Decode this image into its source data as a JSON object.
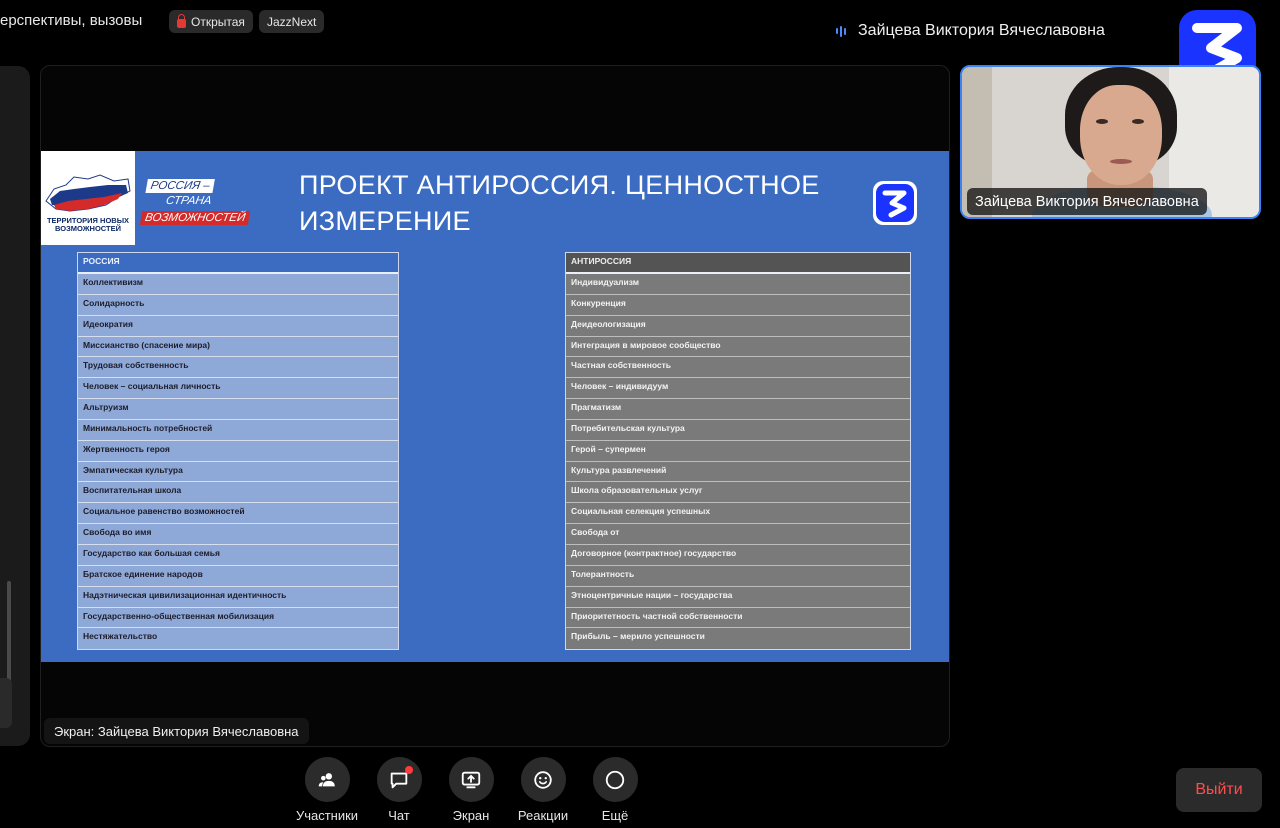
{
  "header": {
    "meeting_title": "ерспективы, вызовы",
    "badge_open": "Открытая",
    "badge_app": "JazzNext",
    "active_speaker": "Зайцева Виктория Вячеславовна"
  },
  "slide": {
    "logo_caption": "ТЕРРИТОРИЯ НОВЫХ ВОЗМОЖНОСТЕЙ",
    "slogan_line1": "РОССИЯ –",
    "slogan_line2": "СТРАНА",
    "slogan_line3": "ВОЗМОЖНОСТЕЙ",
    "title": "ПРОЕКТ АНТИРОССИЯ. ЦЕННОСТНОЕ ИЗМЕРЕНИЕ",
    "left_table": {
      "header": "РОССИЯ",
      "rows": [
        "Коллективизм",
        "Солидарность",
        "Идеократия",
        "Миссианство (спасение мира)",
        "Трудовая собственность",
        "Человек – социальная личность",
        "Альтруизм",
        "Минимальность потребностей",
        "Жертвенность героя",
        "Эмпатическая культура",
        "Воспитательная школа",
        "Социальное равенство возможностей",
        "Свобода во имя",
        "Государство как большая семья",
        "Братское единение народов",
        "Надэтническая цивилизационная идентичность",
        "Государственно-общественная мобилизация",
        "Нестяжательство"
      ]
    },
    "right_table": {
      "header": "АНТИРОССИЯ",
      "rows": [
        "Индивидуализм",
        "Конкуренция",
        "Деидеологизация",
        "Интеграция в мировое сообщество",
        "Частная собственность",
        "Человек – индивидуум",
        "Прагматизм",
        "Потребительская культура",
        "Герой – супермен",
        "Культура развлечений",
        "Школа образовательных услуг",
        "Социальная селекция успешных",
        "Свобода от",
        "Договорное (контрактное) государство",
        "Толерантность",
        "Этноцентричные нации – государства",
        "Приоритетность частной собственности",
        "Прибыль – мерило успешности"
      ]
    }
  },
  "screen_label": "Экран: Зайцева Виктория Вячеславовна",
  "camera": {
    "participant_name": "Зайцева Виктория Вячеславовна"
  },
  "controls": {
    "participants": "Участники",
    "chat": "Чат",
    "screen": "Экран",
    "reactions": "Реакции",
    "more": "Ещё"
  },
  "exit_label": "Выйти",
  "colors": {
    "brand": "#1a33ff",
    "slide_bg": "#3c6cc2",
    "active_border": "#3b82f6",
    "exit_text": "#ff4d4d",
    "notification": "#ff3b3b"
  }
}
